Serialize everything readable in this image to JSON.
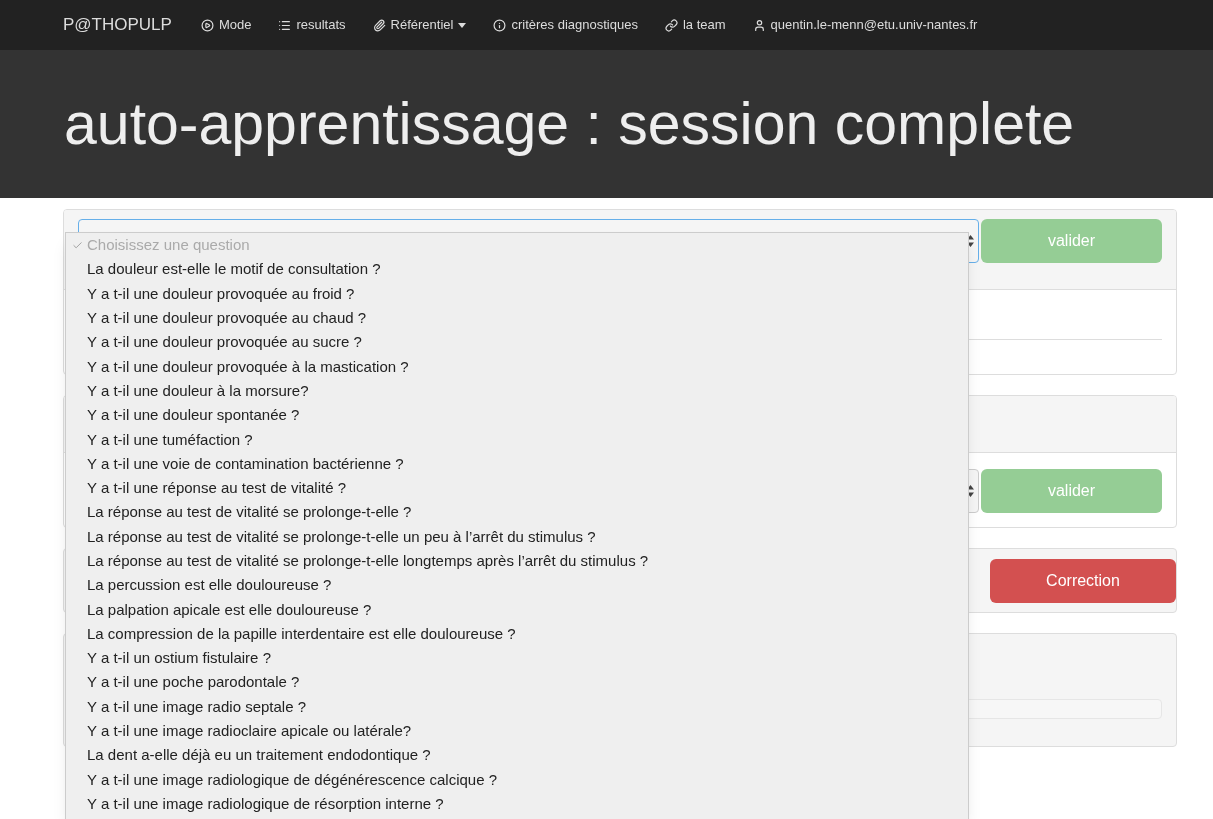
{
  "navbar": {
    "brand": "P@THOPULP",
    "items": [
      {
        "kind": "mode",
        "label": "Mode",
        "dropdown": false
      },
      {
        "kind": "list",
        "label": "resultats",
        "dropdown": false
      },
      {
        "kind": "clip",
        "label": "Référentiel",
        "dropdown": true
      },
      {
        "kind": "info",
        "label": "critères diagnostiques",
        "dropdown": false
      },
      {
        "kind": "link",
        "label": "la team",
        "dropdown": false
      },
      {
        "kind": "user",
        "label": "quentin.le-menn@etu.univ-nantes.fr",
        "dropdown": false
      }
    ]
  },
  "banner": {
    "title": "auto-apprentissage : session complete"
  },
  "panels": [
    {
      "kind": "question",
      "button": "valider"
    },
    {
      "kind": "answer",
      "button": "valider"
    },
    {
      "kind": "correction",
      "button": "Correction"
    },
    {
      "kind": "result"
    }
  ],
  "question_dropdown": {
    "options": [
      {
        "label": "Choisissez une question",
        "selected": true,
        "disabled": true
      },
      {
        "label": "La douleur est-elle le motif de consultation ?",
        "selected": false,
        "disabled": false
      },
      {
        "label": "Y a t-il une douleur provoquée au froid ?",
        "selected": false,
        "disabled": false
      },
      {
        "label": "Y a t-il une douleur provoquée au chaud ?",
        "selected": false,
        "disabled": false
      },
      {
        "label": "Y a t-il une douleur provoquée au sucre ?",
        "selected": false,
        "disabled": false
      },
      {
        "label": "Y a t-il une douleur provoquée à la mastication ?",
        "selected": false,
        "disabled": false
      },
      {
        "label": "Y a t-il une douleur à la morsure?",
        "selected": false,
        "disabled": false
      },
      {
        "label": "Y a t-il une douleur spontanée ?",
        "selected": false,
        "disabled": false
      },
      {
        "label": "Y a t-il une tuméfaction ?",
        "selected": false,
        "disabled": false
      },
      {
        "label": "Y a t-il une voie de contamination bactérienne ?",
        "selected": false,
        "disabled": false
      },
      {
        "label": "Y a t-il une réponse au test de vitalité ?",
        "selected": false,
        "disabled": false
      },
      {
        "label": "La réponse au test de vitalité se prolonge-t-elle ?",
        "selected": false,
        "disabled": false
      },
      {
        "label": "La réponse au test de vitalité se prolonge-t-elle un peu à l’arrêt du stimulus ?",
        "selected": false,
        "disabled": false
      },
      {
        "label": "La réponse au test de vitalité se prolonge-t-elle longtemps après l’arrêt du stimulus ?",
        "selected": false,
        "disabled": false
      },
      {
        "label": "La percussion est elle douloureuse ?",
        "selected": false,
        "disabled": false
      },
      {
        "label": "La palpation apicale est elle douloureuse ?",
        "selected": false,
        "disabled": false
      },
      {
        "label": "La compression de la papille interdentaire est elle douloureuse ?",
        "selected": false,
        "disabled": false
      },
      {
        "label": "Y a t-il un ostium fistulaire ?",
        "selected": false,
        "disabled": false
      },
      {
        "label": "Y a t-il une poche parodontale ?",
        "selected": false,
        "disabled": false
      },
      {
        "label": "Y a t-il une image radio septale ?",
        "selected": false,
        "disabled": false
      },
      {
        "label": "Y a t-il une image radioclaire apicale ou latérale?",
        "selected": false,
        "disabled": false
      },
      {
        "label": "La dent a-elle déjà eu un traitement endodontique ?",
        "selected": false,
        "disabled": false
      },
      {
        "label": "Y a t-il une image radiologique de dégénérescence calcique ?",
        "selected": false,
        "disabled": false
      },
      {
        "label": "Y a t-il une image radiologique de résorption interne ?",
        "selected": false,
        "disabled": false
      }
    ]
  }
}
